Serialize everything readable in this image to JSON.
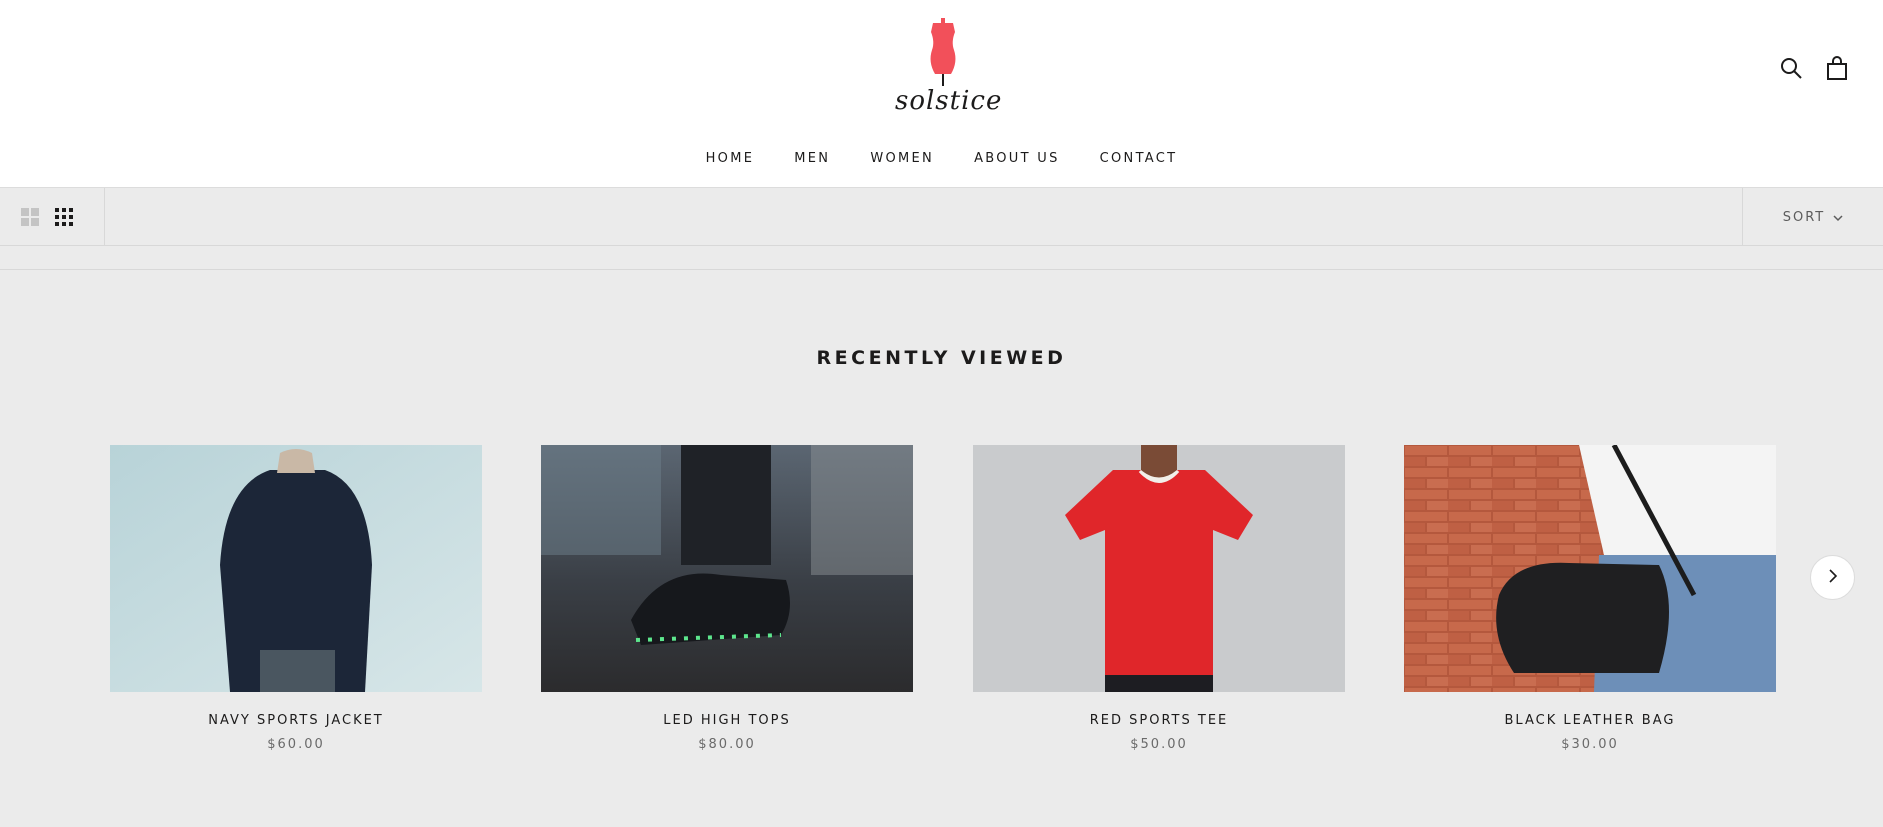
{
  "brand": {
    "name": "solstice",
    "logo_icon": "dress-form-icon",
    "accent_color": "#f2505a"
  },
  "nav": {
    "items": [
      {
        "label": "HOME"
      },
      {
        "label": "MEN"
      },
      {
        "label": "WOMEN"
      },
      {
        "label": "ABOUT US"
      },
      {
        "label": "CONTACT"
      }
    ]
  },
  "header_icons": {
    "search": "search-icon",
    "cart": "shopping-bag-icon"
  },
  "toolbar": {
    "view_options": [
      "grid-2-icon",
      "grid-3-icon"
    ],
    "selected_view": "grid-3-icon",
    "sort_label": "SORT"
  },
  "recently_viewed": {
    "title": "RECENTLY VIEWED",
    "products": [
      {
        "name": "NAVY SPORTS JACKET",
        "price": "$60.00"
      },
      {
        "name": "LED HIGH TOPS",
        "price": "$80.00"
      },
      {
        "name": "RED SPORTS TEE",
        "price": "$50.00"
      },
      {
        "name": "BLACK LEATHER BAG",
        "price": "$30.00"
      }
    ],
    "next_icon": "chevron-right-icon"
  }
}
